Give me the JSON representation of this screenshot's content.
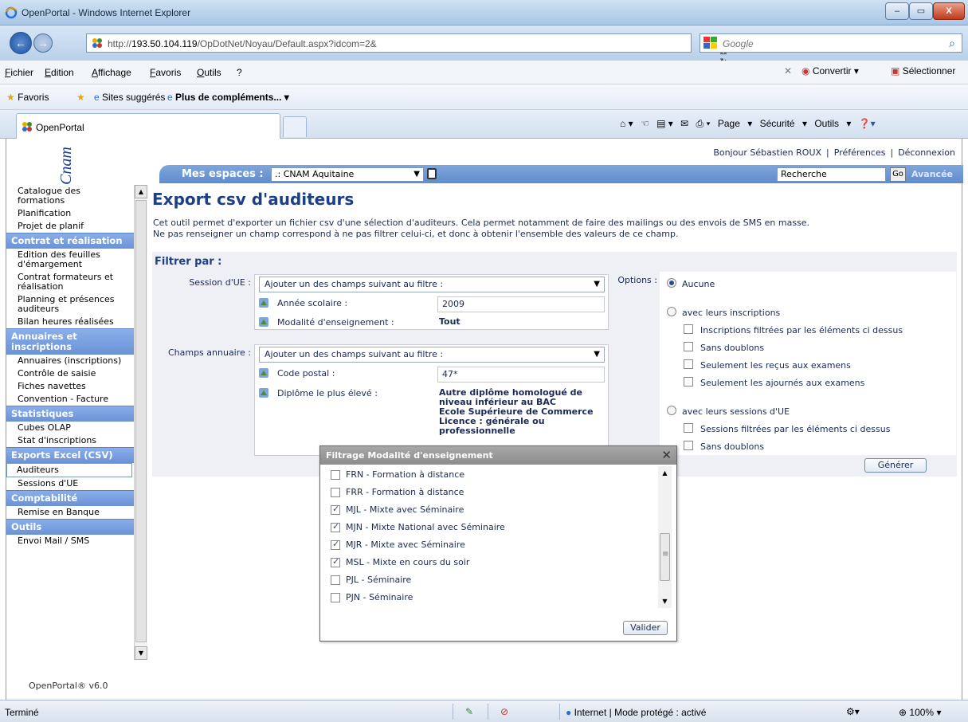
{
  "window": {
    "title": "OpenPortal - Windows Internet Explorer",
    "min_label": "–",
    "max_label": "▭",
    "close_label": "X"
  },
  "address": {
    "url_prefix": "http://",
    "url_host": "193.50.104.119",
    "url_path": "/OpDotNet/Noyau/Default.aspx?idcom=2&",
    "search_placeholder": "Google"
  },
  "menu": {
    "items": [
      "Fichier",
      "Edition",
      "Affichage",
      "Favoris",
      "Outils",
      "?"
    ],
    "convert_label": "Convertir",
    "select_label": "Sélectionner"
  },
  "favorites": {
    "favoris_label": "Favoris",
    "suggested_label": "Sites suggérés",
    "more_label": "Plus de compléments..."
  },
  "tabs": {
    "active_label": "OpenPortal",
    "cmd_page": "Page",
    "cmd_security": "Sécurité",
    "cmd_tools": "Outils"
  },
  "header": {
    "greeting": "Bonjour Sébastien ROUX",
    "preferences": "Préférences",
    "logout": "Déconnexion",
    "logo_text": "Cnam",
    "spaces_label": "Mes espaces :",
    "spaces_value": ".: CNAM Aquitaine",
    "search_value": "Recherche",
    "go_label": "Go",
    "advanced_label": "Avancée"
  },
  "sidebar": {
    "version": "OpenPortal® v6.0",
    "groups": [
      {
        "section": "",
        "items": [
          "Catalogue des formations",
          "Planification",
          "Projet de planif"
        ]
      },
      {
        "section": "Contrat et réalisation",
        "items": [
          "Edition des feuilles d'émargement",
          "Contrat formateurs et réalisation",
          "Planning et présences auditeurs",
          "Bilan heures réalisées"
        ]
      },
      {
        "section": "Annuaires et inscriptions",
        "items": [
          "Annuaires (inscriptions)",
          "Contrôle de saisie",
          "Fiches navettes",
          "Convention - Facture"
        ]
      },
      {
        "section": "Statistiques",
        "items": [
          "Cubes OLAP",
          "Stat d'inscriptions"
        ]
      },
      {
        "section": "Exports Excel (CSV)",
        "items": [
          "Auditeurs",
          "Sessions d'UE"
        ]
      },
      {
        "section": "Comptabilité",
        "items": [
          "Remise en Banque"
        ]
      },
      {
        "section": "Outils",
        "items": [
          "Envoi Mail / SMS"
        ]
      }
    ],
    "active_item": "Auditeurs"
  },
  "main": {
    "title": "Export csv d'auditeurs",
    "intro_line1": "Cet outil permet d'exporter un fichier csv d'une sélection d'auditeurs. Cela permet notamment de faire des mailings ou des envois de SMS en masse.",
    "intro_line2": "Ne pas renseigner un champ correspond à ne pas filtrer celui-ci, et donc à obtenir l'ensemble des valeurs de ce champ.",
    "filter_title": "Filtrer par :",
    "session_label": "Session d'UE :",
    "session_select": "Ajouter un des champs suivant au filtre :",
    "year_label": "Année scolaire :",
    "year_value": "2009",
    "modality_label": "Modalité d'enseignement :",
    "modality_value": "Tout",
    "directory_label": "Champs annuaire :",
    "directory_select": "Ajouter un des champs suivant au filtre :",
    "postal_label": "Code postal :",
    "postal_value": "47*",
    "diploma_label": "Diplôme le plus élevé :",
    "diploma_values": [
      "Autre diplôme homologué de",
      "niveau inférieur au BAC",
      "Ecole Supérieure de Commerce",
      "Licence : générale ou",
      "professionnelle"
    ],
    "options_label": "Options :",
    "opt_none": "Aucune",
    "opt_registrations": "avec leurs inscriptions",
    "opt_reg_filtered": "Inscriptions filtrées par les éléments ci dessus",
    "opt_reg_nodup": "Sans doublons",
    "opt_reg_passed": "Seulement les reçus aux examens",
    "opt_reg_failed": "Seulement les ajournés aux examens",
    "opt_sessions": "avec leurs sessions d'UE",
    "opt_sess_filtered": "Sessions filtrées par les éléments ci dessus",
    "opt_sess_nodup": "Sans doublons",
    "generate_label": "Générer"
  },
  "modal": {
    "title": "Filtrage Modalité d'enseignement",
    "close_label": "✕",
    "validate_label": "Valider",
    "items": [
      {
        "label": "FRN - Formation à distance",
        "checked": false
      },
      {
        "label": "FRR - Formation à distance",
        "checked": false
      },
      {
        "label": "MJL - Mixte avec Séminaire",
        "checked": true
      },
      {
        "label": "MJN - Mixte National avec Séminaire",
        "checked": true
      },
      {
        "label": "MJR - Mixte avec Séminaire",
        "checked": true
      },
      {
        "label": "MSL - Mixte en cours du soir",
        "checked": true
      },
      {
        "label": "PJL - Séminaire",
        "checked": false
      },
      {
        "label": "PJN - Séminaire",
        "checked": false
      }
    ]
  },
  "status": {
    "text": "Terminé",
    "zone": "Internet | Mode protégé : activé",
    "zoom": "100%"
  },
  "colors": {
    "title_blue": "#1d3f86",
    "section_blue": "#6a92d6",
    "panel_bg": "#eef0f5"
  }
}
